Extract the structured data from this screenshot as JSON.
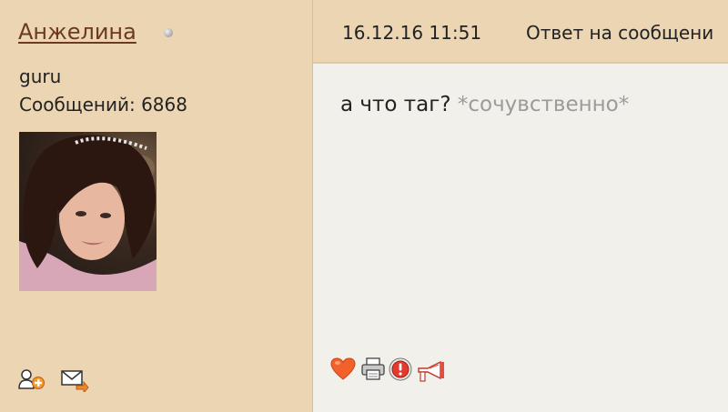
{
  "user": {
    "name": "Анжелина",
    "rank": "guru",
    "posts_label": "Сообщений: 6868",
    "status": "offline",
    "avatar": "user-photo-avatar"
  },
  "user_actions": [
    {
      "icon": "add-friend-icon"
    },
    {
      "icon": "send-message-icon"
    }
  ],
  "message": {
    "date": "16.12.16 11:51",
    "reply_label": "Ответ на сообщени",
    "text": "а что таг?",
    "emote": "*сочувственно*"
  },
  "post_actions": [
    {
      "icon": "heart-icon"
    },
    {
      "icon": "print-icon"
    },
    {
      "icon": "report-icon"
    },
    {
      "icon": "megaphone-icon"
    }
  ],
  "colors": {
    "sidebar_bg": "#ebd5b3",
    "body_bg": "#f2f0eb",
    "username": "#6b3a1f",
    "emote": "#9b9b9b"
  }
}
